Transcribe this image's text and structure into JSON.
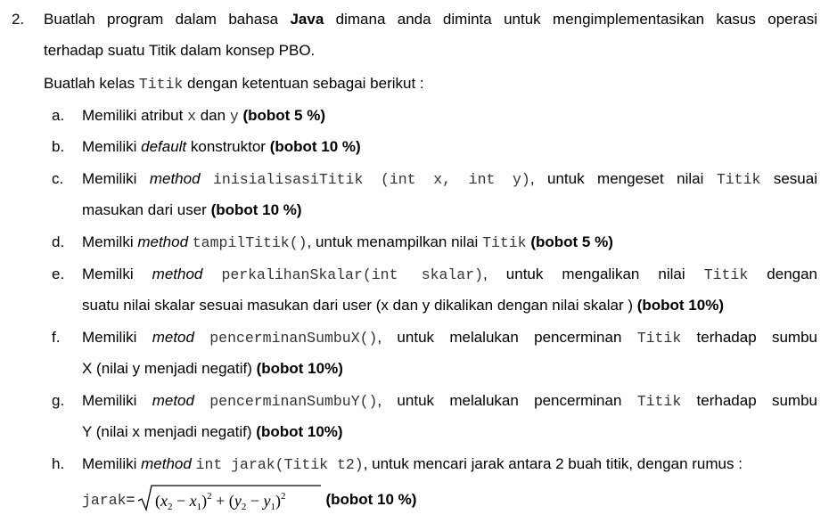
{
  "question": {
    "number": "2.",
    "intro": {
      "l1_a": "Buatlah program dalam bahasa ",
      "l1_java": "Java",
      "l1_b": " dimana anda diminta untuk mengimplementasikan kasus operasi",
      "l2": "terhadap suatu Titik dalam konsep PBO.",
      "l3_a": "Buatlah kelas ",
      "l3_code": "Titik",
      "l3_b": " dengan ketentuan sebagai berikut :"
    },
    "items": {
      "a": {
        "letter": "a.",
        "t1": "Memiliki atribut ",
        "c1": "x",
        "t2": " dan ",
        "c2": "y",
        "t3": " ",
        "bobot": "(bobot 5 %)"
      },
      "b": {
        "letter": "b.",
        "t1": "Memiliki ",
        "it1": "default",
        "t2": " konstruktor ",
        "bobot": "(bobot 10 %)"
      },
      "c": {
        "letter": "c.",
        "t1": "Memiliki ",
        "it1": "method",
        "t2": " ",
        "c1": "inisialisasiTitik (int x, int y)",
        "t3": ", untuk mengeset nilai ",
        "c2": "Titik",
        "t4": " sesuai",
        "l2_t": "masukan dari user ",
        "bobot": "(bobot 10 %)"
      },
      "d": {
        "letter": "d.",
        "t1": "Memilki ",
        "it1": "method",
        "t2": " ",
        "c1": "tampilTitik()",
        "t3": ", untuk menampilkan nilai ",
        "c2": "Titik",
        "t4": " ",
        "bobot": "(bobot 5 %)"
      },
      "e": {
        "letter": "e.",
        "t1": "Memilki ",
        "it1": "method",
        "t2": " ",
        "c1": "perkalihanSkalar(int skalar)",
        "t3": ", untuk mengalikan nilai ",
        "c2": "Titik",
        "t4": " dengan",
        "l2_t": "suatu nilai skalar sesuai masukan dari user (x dan y dikalikan dengan nilai skalar ) ",
        "bobot": "(bobot 10%)"
      },
      "f": {
        "letter": "f.",
        "t1": "Memiliki ",
        "it1": "metod",
        "t2": " ",
        "c1": "pencerminanSumbuX()",
        "t3": ", untuk melalukan pencerminan ",
        "c2": "Titik",
        "t4": " terhadap sumbu",
        "l2_t": "X (nilai y menjadi negatif) ",
        "bobot": "(bobot 10%)"
      },
      "g": {
        "letter": "g.",
        "t1": "Memiliki ",
        "it1": "metod",
        "t2": " ",
        "c1": "pencerminanSumbuY()",
        "t3": ", untuk melalukan pencerminan ",
        "c2": "Titik",
        "t4": " terhadap sumbu",
        "l2_t": "Y (nilai x menjadi negatif) ",
        "bobot": "(bobot 10%)"
      },
      "h": {
        "letter": "h.",
        "t1": "Memiliki ",
        "it1": "method",
        "t2": " ",
        "c1": "int jarak(Titik t2)",
        "t3": ", untuk mencari jarak antara 2 buah titik, dengan rumus :",
        "formula_code": "jarak",
        "formula_eq": "=",
        "bobot": "(bobot 10 %)"
      }
    }
  }
}
